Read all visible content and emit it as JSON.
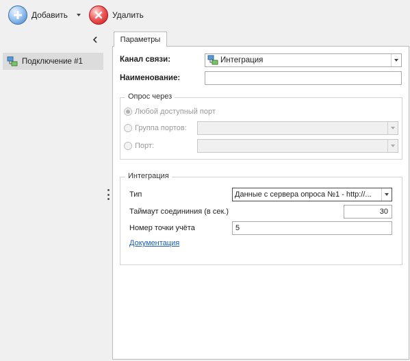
{
  "toolbar": {
    "add_label": "Добавить",
    "delete_label": "Удалить"
  },
  "sidebar": {
    "collapse_glyph": "‹",
    "items": [
      {
        "label": "Подключение #1",
        "icon": "connection-icon"
      }
    ]
  },
  "tabs": [
    {
      "label": "Параметры"
    }
  ],
  "form": {
    "channel_label": "Канал связи:",
    "channel_value": "Интеграция",
    "name_label": "Наименование:",
    "name_value": ""
  },
  "poll_group": {
    "title": "Опрос через",
    "option_any": "Любой доступный порт",
    "option_group": "Группа портов:",
    "option_port": "Порт:"
  },
  "integration_group": {
    "title": "Интеграция",
    "type_label": "Тип",
    "type_value": "Данные с сервера опроса №1 - http://...",
    "timeout_label": "Таймаут соедининия (в сек.)",
    "timeout_value": "30",
    "meter_point_label": "Номер точки учёта",
    "meter_point_value": "5",
    "docs_link": "Документация"
  },
  "colors": {
    "link": "#1b5fb8",
    "add_icon": "#3f7fc6",
    "delete_icon": "#c11717"
  }
}
